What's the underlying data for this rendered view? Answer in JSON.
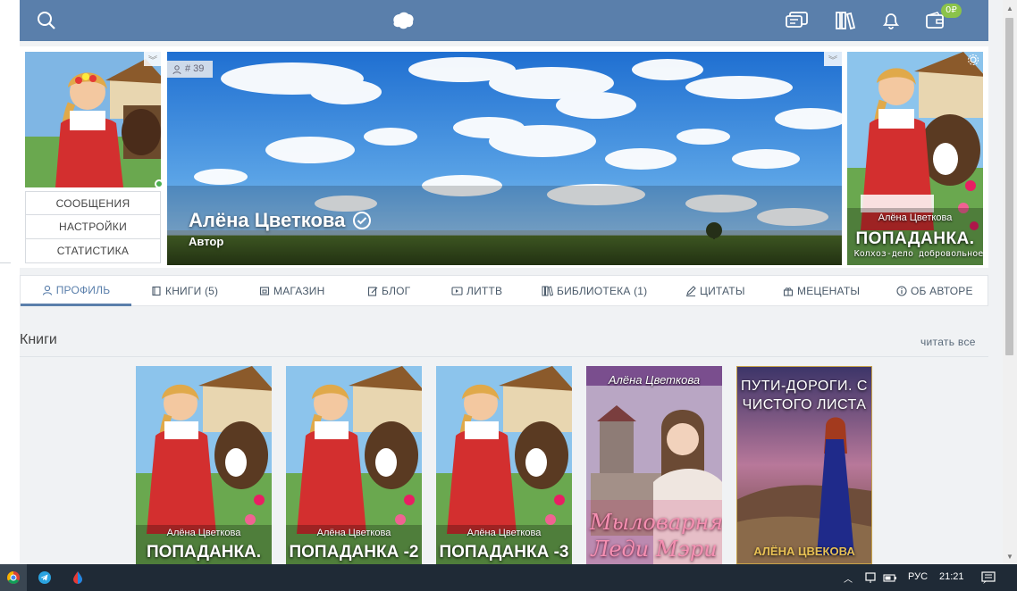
{
  "header": {
    "badge": "0₽"
  },
  "profile": {
    "followers": "# 39",
    "name": "Алёна Цветкова",
    "role": "Автор",
    "menu": [
      "СООБЩЕНИЯ",
      "НАСТРОЙКИ",
      "СТАТИСТИКА"
    ]
  },
  "side_book": {
    "author": "Алёна Цветкова",
    "title": "ПОПАДАНКА.",
    "subtitle": "Колхоз-дело добровольное"
  },
  "tabs": [
    {
      "label": "ПРОФИЛЬ",
      "icon": "user-icon"
    },
    {
      "label": "КНИГИ (5)",
      "icon": "book-icon"
    },
    {
      "label": "МАГАЗИН",
      "icon": "shop-icon"
    },
    {
      "label": "БЛОГ",
      "icon": "edit-icon"
    },
    {
      "label": "ЛИТТВ",
      "icon": "video-icon"
    },
    {
      "label": "БИБЛИОТЕКА (1)",
      "icon": "library-icon"
    },
    {
      "label": "ЦИТАТЫ",
      "icon": "marker-icon"
    },
    {
      "label": "МЕЦЕНАТЫ",
      "icon": "gift-icon"
    },
    {
      "label": "ОБ АВТОРЕ",
      "icon": "info-icon"
    }
  ],
  "books_section": {
    "title": "Книги",
    "read_all": "читать все"
  },
  "books": [
    {
      "author": "Алёна Цветкова",
      "title": "ПОПАДАНКА."
    },
    {
      "author": "Алёна Цветкова",
      "title": "ПОПАДАНКА -2"
    },
    {
      "author": "Алёна Цветкова",
      "title": "ПОПАДАНКА -3"
    },
    {
      "author": "Алёна Цветкова",
      "title": "Мыловарня Леди Мэри"
    },
    {
      "author": "АЛЁНА ЦВЕКОВА",
      "title": "ПУТИ-ДОРОГИ. С ЧИСТОГО ЛИСТА"
    }
  ],
  "taskbar": {
    "lang": "РУС",
    "time": "21:21"
  },
  "colors": {
    "accent": "#5a7fab",
    "badge": "#8bc34a",
    "taskbar": "#1f2a36"
  }
}
